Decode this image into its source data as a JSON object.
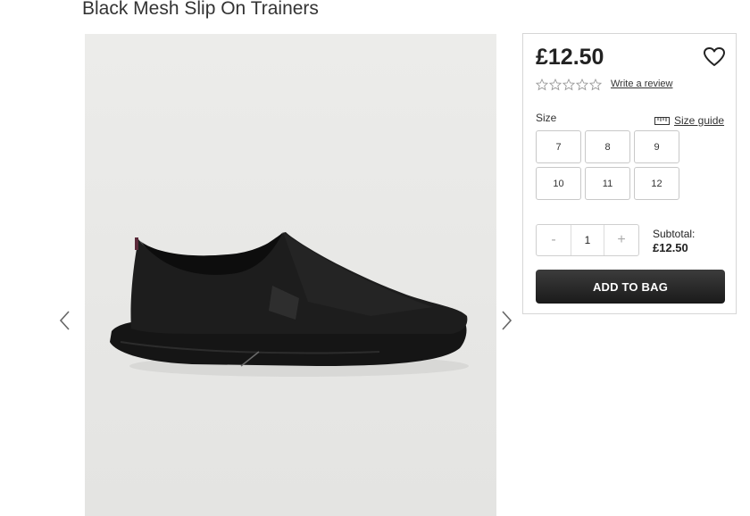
{
  "product": {
    "title": "Black Mesh Slip On Trainers",
    "price": "£12.50",
    "rating_stars": 5,
    "review_link": "Write a review"
  },
  "icons": {
    "wishlist": "heart-icon",
    "ruler": "ruler-icon",
    "prev": "chevron-left-icon",
    "next": "chevron-right-icon"
  },
  "sizes": {
    "label": "Size",
    "guide_label": "Size guide",
    "options": [
      "7",
      "8",
      "9",
      "10",
      "11",
      "12"
    ]
  },
  "quantity": {
    "minus": "-",
    "value": "1",
    "plus": "+"
  },
  "subtotal": {
    "label": "Subtotal:",
    "value": "£12.50"
  },
  "add_to_bag": "ADD TO BAG",
  "colors": {
    "button": "#2a2a2a",
    "background_image": "#e8e8e6"
  }
}
